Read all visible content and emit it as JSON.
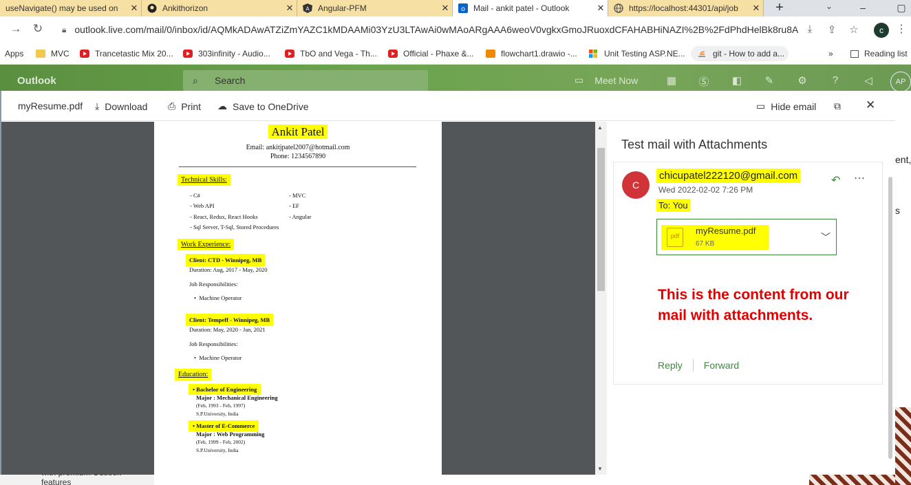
{
  "browser": {
    "tabs": [
      {
        "label": "useNavigate() may be used on",
        "icon": "document-icon"
      },
      {
        "label": "Ankithorizon",
        "icon": "github-icon"
      },
      {
        "label": "Angular-PFM",
        "icon": "angular-icon"
      },
      {
        "label": "Mail - ankit patel - Outlook",
        "icon": "outlook-icon",
        "active": true
      },
      {
        "label": "https://localhost:44301/api/job",
        "icon": "globe-icon"
      }
    ],
    "url": "outlook.live.com/mail/0/inbox/id/AQMkADAwATZiZmYAZC1kMDAAMi03YzU3LTAwAi0wMAoARgAAA6weoV0vgkxGmoJRuoxdCFAHABHiNAZI%2B%2FdPhdHelBk8ru8A...",
    "profile_initial": "c",
    "bookmarks": [
      {
        "label": "Apps",
        "icon": "apps-grid-icon"
      },
      {
        "label": "MVC",
        "icon": "folder-icon"
      },
      {
        "label": "Trancetastic Mix 20...",
        "icon": "youtube-icon"
      },
      {
        "label": "303infinity - Audio...",
        "icon": "youtube-icon"
      },
      {
        "label": "TbO and Vega - Th...",
        "icon": "youtube-icon"
      },
      {
        "label": "Official - Phaxe &...",
        "icon": "youtube-icon"
      },
      {
        "label": "flowchart1.drawio -...",
        "icon": "drawio-icon"
      },
      {
        "label": "Unit Testing ASP.NE...",
        "icon": "microsoft-icon"
      },
      {
        "label": "git - How to add a...",
        "icon": "stackoverflow-icon"
      }
    ],
    "more_bookmarks": "»",
    "reading_list": "Reading list"
  },
  "outlook": {
    "brand": "Outlook",
    "search_placeholder": "Search",
    "meet_now": "Meet Now",
    "avatar_initials": "AP"
  },
  "viewer": {
    "filename": "myResume.pdf",
    "download": "Download",
    "print": "Print",
    "save_onedrive": "Save to OneDrive",
    "hide_email": "Hide email"
  },
  "resume": {
    "name": "Ankit Patel",
    "email": "Email: ankitjpatel2007@hotmail.com",
    "phone": "Phone: 1234567890",
    "technical_heading": "Technical Skills:",
    "skills_left": [
      "- C#",
      "- Web API",
      "- React, Redux, React Hooks",
      "- Sql Server, T-Sql, Stored Procedures"
    ],
    "skills_right": [
      "- MVC",
      "- EF",
      "- Angular"
    ],
    "work_heading": "Work Experience:",
    "jobs": [
      {
        "client": "Client: CTD - Winnipeg, MB",
        "duration": "Duration: Aug, 2017 - May, 2020",
        "resp_label": "Job Responsibilities:",
        "resp": "Machine Operator"
      },
      {
        "client": "Client: Tempeff - Winnipeg, MB",
        "duration": "Duration: May, 2020 - Jan, 2021",
        "resp_label": "Job Responsibilities:",
        "resp": "Machine Operator"
      }
    ],
    "education_heading": "Education:",
    "education": [
      {
        "degree": "Bachelor of Engineering",
        "major": "Major : Mechanical Engineering",
        "dates": "(Feb, 1993 - Feb, 1997)",
        "school": "S.P.University, India"
      },
      {
        "degree": "Master of E-Commerce",
        "major": "Major : Web Programming",
        "dates": "(Feb, 1999 - Feb, 2002)",
        "school": "S.P.University, India"
      }
    ]
  },
  "mail": {
    "subject": "Test mail with Attachments",
    "sender_initial": "C",
    "sender": "chicupatel222120@gmail.com",
    "date": "Wed 2022-02-02 7:26 PM",
    "to": "To:  You",
    "attachment": {
      "name": "myResume.pdf",
      "size": "67 KB",
      "icon_label": "pdf"
    },
    "body": "This is the content from our mail with attachments.",
    "reply": "Reply",
    "forward": "Forward"
  },
  "background": {
    "right_fragment_1": "ent,",
    "right_fragment_2": "s",
    "promo_text": "with premium Outlook features"
  },
  "colors": {
    "outlook_header": "#6aa44c",
    "highlight": "#ffff00",
    "accent_green": "#3a8a3a",
    "body_red": "#e00000",
    "avatar_red": "#d13438",
    "tab_inactive": "#f6e0a4"
  }
}
